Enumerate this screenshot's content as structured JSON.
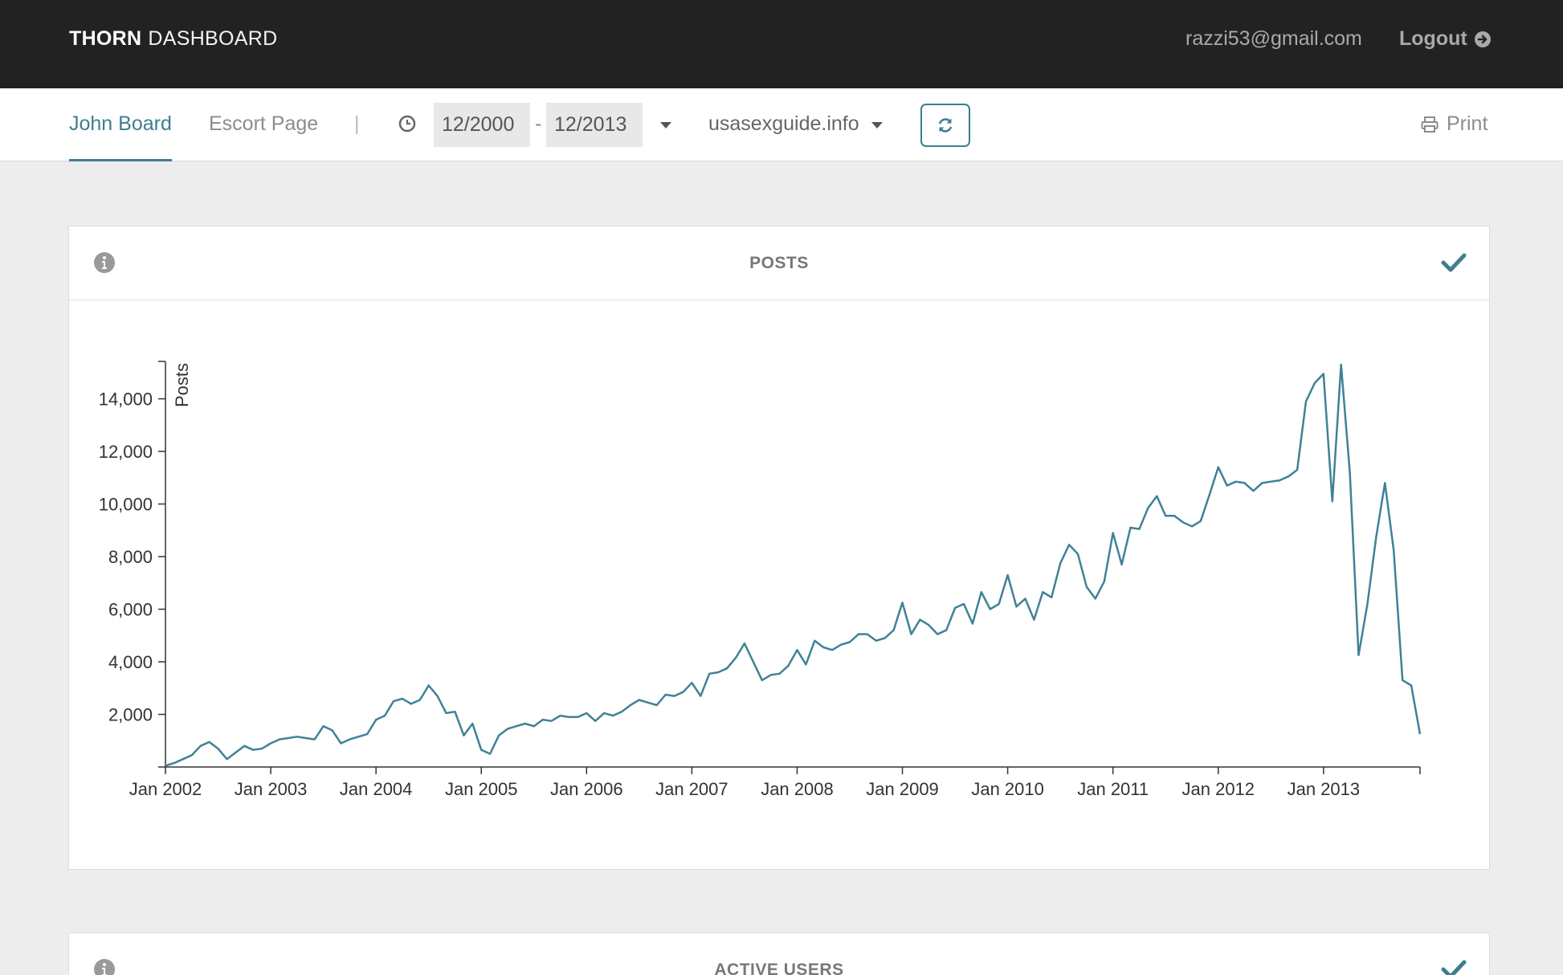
{
  "header": {
    "brand_bold": "THORN",
    "brand_light": "DASHBOARD",
    "user_email": "razzi53@gmail.com",
    "logout_label": "Logout"
  },
  "subnav": {
    "tabs": [
      {
        "label": "John Board",
        "active": true
      },
      {
        "label": "Escort Page",
        "active": false
      }
    ],
    "separator": "|",
    "date_from": "12/2000",
    "date_dash": "-",
    "date_to": "12/2013",
    "site": "usasexguide.info",
    "print_label": "Print"
  },
  "colors": {
    "accent": "#3e7e8f",
    "topbar": "#222222",
    "line": "#3f8296"
  },
  "icons": {
    "clock": "clock-icon",
    "refresh": "refresh-icon",
    "print": "print-icon",
    "info": "info-icon",
    "check": "check-icon",
    "logout": "logout-arrow-icon"
  },
  "panels": [
    {
      "title": "POSTS"
    },
    {
      "title": "ACTIVE USERS"
    }
  ],
  "chart_data": {
    "type": "line",
    "title": "",
    "xlabel": "",
    "ylabel": "Posts",
    "ylim": [
      0,
      15300
    ],
    "xlim": [
      "2002-01",
      "2013-12"
    ],
    "yticks": [
      2000,
      4000,
      6000,
      8000,
      10000,
      12000,
      14000
    ],
    "ytick_labels": [
      "2,000",
      "4,000",
      "6,000",
      "8,000",
      "10,000",
      "12,000",
      "14,000"
    ],
    "xticks": [
      "2002-01",
      "2003-01",
      "2004-01",
      "2005-01",
      "2006-01",
      "2007-01",
      "2008-01",
      "2009-01",
      "2010-01",
      "2011-01",
      "2012-01",
      "2013-01"
    ],
    "xtick_labels": [
      "Jan 2002",
      "Jan 2003",
      "Jan 2004",
      "Jan 2005",
      "Jan 2006",
      "Jan 2007",
      "Jan 2008",
      "Jan 2009",
      "Jan 2010",
      "Jan 2011",
      "Jan 2012",
      "Jan 2013"
    ],
    "grid": false,
    "series": [
      {
        "x": [
          "2002-01",
          "2002-02",
          "2002-03",
          "2002-04",
          "2002-05",
          "2002-06",
          "2002-07",
          "2002-08",
          "2002-09",
          "2002-10",
          "2002-11",
          "2002-12",
          "2003-01",
          "2003-02",
          "2003-03",
          "2003-04",
          "2003-05",
          "2003-06",
          "2003-07",
          "2003-08",
          "2003-09",
          "2003-10",
          "2003-11",
          "2003-12",
          "2004-01",
          "2004-02",
          "2004-03",
          "2004-04",
          "2004-05",
          "2004-06",
          "2004-07",
          "2004-08",
          "2004-09",
          "2004-10",
          "2004-11",
          "2004-12",
          "2005-01",
          "2005-02",
          "2005-03",
          "2005-04",
          "2005-05",
          "2005-06",
          "2005-07",
          "2005-08",
          "2005-09",
          "2005-10",
          "2005-11",
          "2005-12",
          "2006-01",
          "2006-02",
          "2006-03",
          "2006-04",
          "2006-05",
          "2006-06",
          "2006-07",
          "2006-08",
          "2006-09",
          "2006-10",
          "2006-11",
          "2006-12",
          "2007-01",
          "2007-02",
          "2007-03",
          "2007-04",
          "2007-05",
          "2007-06",
          "2007-07",
          "2007-08",
          "2007-09",
          "2007-10",
          "2007-11",
          "2007-12",
          "2008-01",
          "2008-02",
          "2008-03",
          "2008-04",
          "2008-05",
          "2008-06",
          "2008-07",
          "2008-08",
          "2008-09",
          "2008-10",
          "2008-11",
          "2008-12",
          "2009-01",
          "2009-02",
          "2009-03",
          "2009-04",
          "2009-05",
          "2009-06",
          "2009-07",
          "2009-08",
          "2009-09",
          "2009-10",
          "2009-11",
          "2009-12",
          "2010-01",
          "2010-02",
          "2010-03",
          "2010-04",
          "2010-05",
          "2010-06",
          "2010-07",
          "2010-08",
          "2010-09",
          "2010-10",
          "2010-11",
          "2010-12",
          "2011-01",
          "2011-02",
          "2011-03",
          "2011-04",
          "2011-05",
          "2011-06",
          "2011-07",
          "2011-08",
          "2011-09",
          "2011-10",
          "2011-11",
          "2011-12",
          "2012-01",
          "2012-02",
          "2012-03",
          "2012-04",
          "2012-05",
          "2012-06",
          "2012-07",
          "2012-08",
          "2012-09",
          "2012-10",
          "2012-11",
          "2012-12",
          "2013-01",
          "2013-02",
          "2013-03",
          "2013-04",
          "2013-05",
          "2013-06",
          "2013-07",
          "2013-08",
          "2013-09",
          "2013-10",
          "2013-11",
          "2013-12"
        ],
        "values": [
          50,
          150,
          300,
          450,
          800,
          950,
          700,
          300,
          550,
          800,
          650,
          700,
          900,
          1050,
          1100,
          1150,
          1100,
          1050,
          1550,
          1400,
          900,
          1050,
          1150,
          1250,
          1800,
          1950,
          2500,
          2600,
          2400,
          2550,
          3100,
          2700,
          2050,
          2100,
          1200,
          1650,
          650,
          500,
          1200,
          1450,
          1550,
          1650,
          1550,
          1800,
          1750,
          1950,
          1900,
          1900,
          2050,
          1750,
          2050,
          1950,
          2100,
          2350,
          2550,
          2450,
          2350,
          2750,
          2700,
          2850,
          3200,
          2700,
          3550,
          3600,
          3750,
          4150,
          4700,
          4000,
          3300,
          3500,
          3550,
          3850,
          4450,
          3900,
          4800,
          4550,
          4450,
          4650,
          4750,
          5050,
          5050,
          4800,
          4900,
          5200,
          6250,
          5050,
          5600,
          5400,
          5050,
          5200,
          6050,
          6200,
          5450,
          6650,
          6000,
          6200,
          7300,
          6100,
          6400,
          5600,
          6650,
          6450,
          7750,
          8450,
          8100,
          6850,
          6400,
          7050,
          8900,
          7700,
          9100,
          9050,
          9850,
          10300,
          9550,
          9550,
          9300,
          9150,
          9350,
          10350,
          11400,
          10700,
          10850,
          10800,
          10500,
          10800,
          10850,
          10900,
          11050,
          11300,
          13900,
          14600,
          14950,
          10100,
          15300,
          11200,
          4250,
          6200,
          8750,
          10800,
          8250,
          3300,
          3100,
          1250
        ]
      }
    ]
  }
}
